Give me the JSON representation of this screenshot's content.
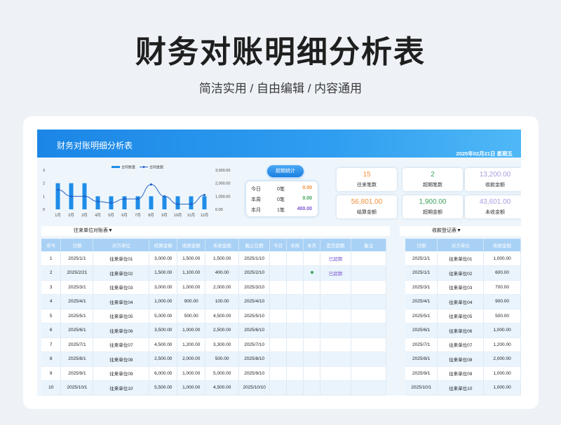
{
  "hero": {
    "title": "财务对账明细分析表",
    "subtitle": "简洁实用 / 自由编辑 / 内容通用"
  },
  "banner": {
    "title": "财务对账明细分析表",
    "date": "2025年02月21日  星期五"
  },
  "chart_data": {
    "type": "bar+line",
    "categories": [
      "1月",
      "2月",
      "3月",
      "4月",
      "5月",
      "6月",
      "7月",
      "8月",
      "9月",
      "10月",
      "11月",
      "12月"
    ],
    "series": [
      {
        "name": "合同数量",
        "axis": "left",
        "type": "bar",
        "values": [
          2,
          2,
          2,
          1,
          1,
          1,
          1,
          1,
          1,
          1,
          1,
          1
        ]
      },
      {
        "name": "合同金额",
        "axis": "right",
        "type": "line",
        "values": [
          1500,
          1000,
          1000,
          600,
          500,
          800,
          800,
          1900,
          1000,
          400,
          400,
          1100
        ]
      }
    ],
    "left_axis": {
      "ticks": [
        "3",
        "2",
        "1",
        "0"
      ],
      "ylim": [
        0,
        3
      ]
    },
    "right_axis": {
      "ticks": [
        "3,000.00",
        "2,000.00",
        "1,000.00",
        "0.00"
      ],
      "ylim": [
        0,
        3000
      ]
    },
    "legend_position": "top",
    "colors": {
      "bar": "#1f8de8",
      "line": "#2563c7"
    }
  },
  "period": {
    "button_label": "超期统计",
    "rows": [
      {
        "label": "今日",
        "count": "0笔",
        "amount": "0.00",
        "color": "#f0913a"
      },
      {
        "label": "本周",
        "count": "0笔",
        "amount": "0.00",
        "color": "#3fa35a"
      },
      {
        "label": "本月",
        "count": "1笔",
        "amount": "400.00",
        "color": "#7b56d0"
      }
    ]
  },
  "stats": [
    {
      "value": "15",
      "label": "往来笔数",
      "color": "#f0913a"
    },
    {
      "value": "2",
      "label": "超期笔数",
      "color": "#3fa35a"
    },
    {
      "value": "13,200.00",
      "label": "收款金额",
      "color": "#a99ee0"
    },
    {
      "value": "56,801.00",
      "label": "结算金额",
      "color": "#f0913a"
    },
    {
      "value": "1,900.00",
      "label": "超期金额",
      "color": "#3fa35a"
    },
    {
      "value": "43,601.00",
      "label": "未收金额",
      "color": "#a99ee0"
    }
  ],
  "ledger": {
    "section_label": "往来单位对账表▼",
    "headers": [
      "序号",
      "日期",
      "对方单位",
      "结算金额",
      "收款金额",
      "未收金额",
      "截止日期",
      "今日",
      "本周",
      "本月",
      "是否超期",
      "备注"
    ],
    "rows": [
      [
        "1",
        "2025/1/1",
        "往来单位01",
        "3,000.00",
        "1,500.00",
        "1,500.00",
        "2025/1/10",
        "",
        "",
        "",
        "已超期",
        ""
      ],
      [
        "2",
        "2025/2/21",
        "往来单位02",
        "1,500.00",
        "1,100.00",
        "400.00",
        "2025/2/10",
        "",
        "",
        "●",
        "已超期",
        ""
      ],
      [
        "3",
        "2025/3/1",
        "往来单位03",
        "3,000.00",
        "1,000.00",
        "2,000.00",
        "2025/3/10",
        "",
        "",
        "",
        "",
        ""
      ],
      [
        "4",
        "2025/4/1",
        "往来单位04",
        "1,000.00",
        "900.00",
        "100.00",
        "2025/4/10",
        "",
        "",
        "",
        "",
        ""
      ],
      [
        "5",
        "2025/5/1",
        "往来单位05",
        "5,000.00",
        "500.00",
        "4,500.00",
        "2025/5/10",
        "",
        "",
        "",
        "",
        ""
      ],
      [
        "6",
        "2025/6/1",
        "往来单位06",
        "3,500.00",
        "1,000.00",
        "2,500.00",
        "2025/6/10",
        "",
        "",
        "",
        "",
        ""
      ],
      [
        "7",
        "2025/7/1",
        "往来单位07",
        "4,500.00",
        "1,200.00",
        "3,300.00",
        "2025/7/10",
        "",
        "",
        "",
        "",
        ""
      ],
      [
        "8",
        "2025/8/1",
        "往来单位08",
        "2,500.00",
        "2,000.00",
        "500.00",
        "2025/8/10",
        "",
        "",
        "",
        "",
        ""
      ],
      [
        "9",
        "2025/9/1",
        "往来单位09",
        "6,000.00",
        "1,000.00",
        "5,000.00",
        "2025/9/10",
        "",
        "",
        "",
        "",
        ""
      ],
      [
        "10",
        "2025/10/1",
        "往来单位10",
        "5,500.00",
        "1,000.00",
        "4,500.00",
        "2025/10/10",
        "",
        "",
        "",
        "",
        ""
      ]
    ]
  },
  "receipts": {
    "section_label": "收款登记表▼",
    "headers": [
      "日期",
      "对方单位",
      "收款金额"
    ],
    "rows": [
      [
        "2025/1/1",
        "往来单位01",
        "1,000.00"
      ],
      [
        "2025/1/1",
        "往来单位02",
        "600.00"
      ],
      [
        "2025/3/1",
        "往来单位03",
        "700.00"
      ],
      [
        "2025/4/1",
        "往来单位04",
        "900.00"
      ],
      [
        "2025/5/1",
        "往来单位05",
        "500.00"
      ],
      [
        "2025/6/1",
        "往来单位06",
        "1,000.00"
      ],
      [
        "2025/7/1",
        "往来单位07",
        "1,200.00"
      ],
      [
        "2025/8/1",
        "往来单位08",
        "2,000.00"
      ],
      [
        "2025/9/1",
        "往来单位09",
        "1,000.00"
      ],
      [
        "2025/10/1",
        "往来单位10",
        "1,000.00"
      ]
    ]
  }
}
